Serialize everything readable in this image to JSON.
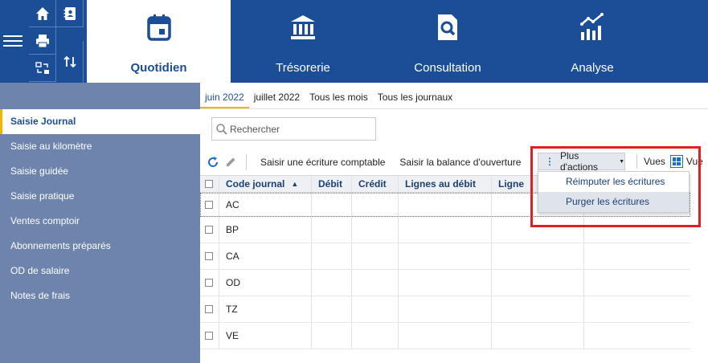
{
  "topnav": {
    "items": [
      {
        "label": "Quotidien",
        "icon": "calendar-icon"
      },
      {
        "label": "Trésorerie",
        "icon": "bank-icon"
      },
      {
        "label": "Consultation",
        "icon": "document-search-icon"
      },
      {
        "label": "Analyse",
        "icon": "chart-icon"
      }
    ],
    "quick_icons": [
      "home-icon",
      "contacts-icon",
      "print-icon",
      "swap-icon",
      "sort-updown-icon"
    ],
    "active_color": "#1b4e96"
  },
  "sidebar": {
    "items": [
      {
        "label": "Saisie Journal"
      },
      {
        "label": "Saisie au kilomètre"
      },
      {
        "label": "Saisie guidée"
      },
      {
        "label": "Saisie pratique"
      },
      {
        "label": "Ventes comptoir"
      },
      {
        "label": "Abonnements préparés"
      },
      {
        "label": "OD de salaire"
      },
      {
        "label": "Notes de frais"
      }
    ],
    "active": "Saisie Journal"
  },
  "periods": [
    "juin 2022",
    "juillet 2022",
    "Tous les mois",
    "Tous les journaux"
  ],
  "search": {
    "placeholder": "Rechercher"
  },
  "toolbar": {
    "new_entry": "Saisir une écriture comptable",
    "opening_balance": "Saisir la balance d'ouverture",
    "more_actions": "Plus d'actions",
    "views": "Vues",
    "views_cut": "Vue"
  },
  "dropdown": {
    "items": [
      "Réimputer les écritures",
      "Purger les écritures"
    ]
  },
  "grid": {
    "columns": [
      "Code journal",
      "Débit",
      "Crédit",
      "Lignes au débit",
      "Ligne"
    ],
    "rows": [
      "AC",
      "BP",
      "CA",
      "OD",
      "TZ",
      "VE"
    ]
  },
  "colors": {
    "accent": "#f2b500",
    "highlight": "#e02020",
    "sidebar": "#6e84ad"
  }
}
